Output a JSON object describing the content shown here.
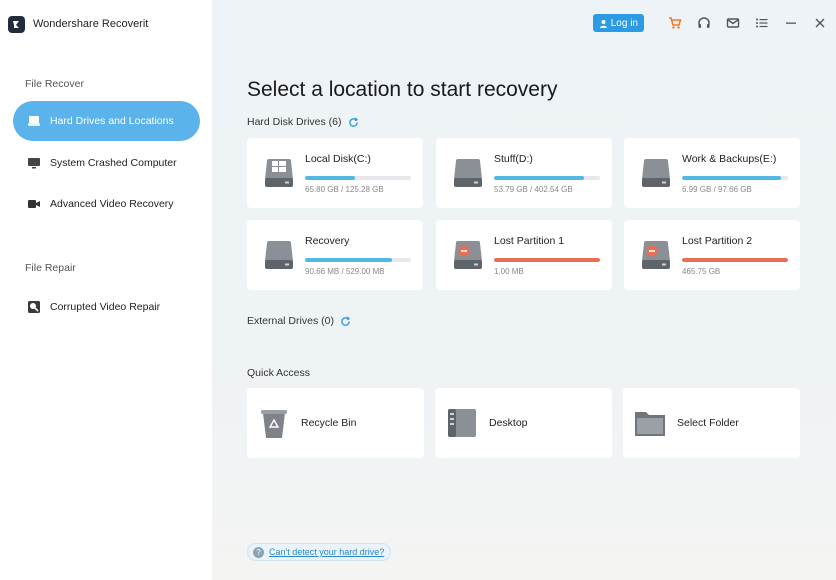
{
  "app": {
    "title": "Wondershare Recoverit"
  },
  "sidebar": {
    "sections": [
      {
        "label": "File Recover",
        "items": [
          {
            "label": "Hard Drives and Locations",
            "icon": "hard-drive-icon",
            "active": true
          },
          {
            "label": "System Crashed Computer",
            "icon": "monitor-icon",
            "active": false
          },
          {
            "label": "Advanced Video Recovery",
            "icon": "video-camera-icon",
            "active": false
          }
        ]
      },
      {
        "label": "File Repair",
        "items": [
          {
            "label": "Corrupted Video Repair",
            "icon": "video-repair-icon",
            "active": false
          }
        ]
      }
    ]
  },
  "topbar": {
    "login_label": "Log in",
    "icons": [
      "cart-icon",
      "headset-icon",
      "mail-icon",
      "menu-icon",
      "minimize-icon",
      "close-icon"
    ]
  },
  "main": {
    "title": "Select a location to start recovery",
    "hard_disk_heading": "Hard Disk Drives (6)",
    "external_heading": "External Drives (0)",
    "quick_access_heading": "Quick Access",
    "help_link": "Can't detect your hard drive?"
  },
  "drives": [
    {
      "name": "Local Disk(C:)",
      "size": "65.80 GB / 125.28 GB",
      "used": 0.47,
      "status": "ok",
      "system": true
    },
    {
      "name": "Stuff(D:)",
      "size": "53.79 GB / 402.54 GB",
      "used": 0.85,
      "status": "ok",
      "system": false
    },
    {
      "name": "Work & Backups(E:)",
      "size": "6.99 GB / 97.66 GB",
      "used": 0.93,
      "status": "ok",
      "system": false
    },
    {
      "name": "Recovery",
      "size": "90.66 MB / 529.00 MB",
      "used": 0.82,
      "status": "ok",
      "system": false
    },
    {
      "name": "Lost Partition 1",
      "size": "1.00 MB",
      "used": 1.0,
      "status": "lost",
      "system": false
    },
    {
      "name": "Lost Partition 2",
      "size": "465.75 GB",
      "used": 1.0,
      "status": "lost",
      "system": false
    }
  ],
  "quick_access": [
    {
      "label": "Recycle Bin",
      "icon": "recycle-bin-icon"
    },
    {
      "label": "Desktop",
      "icon": "desktop-icon"
    },
    {
      "label": "Select Folder",
      "icon": "folder-icon"
    }
  ],
  "colors": {
    "accent": "#5ab3ea",
    "login": "#2b9be5",
    "bar_ok": "#52b7e2",
    "bar_lost": "#e86f55",
    "cart": "#f07a2a"
  }
}
